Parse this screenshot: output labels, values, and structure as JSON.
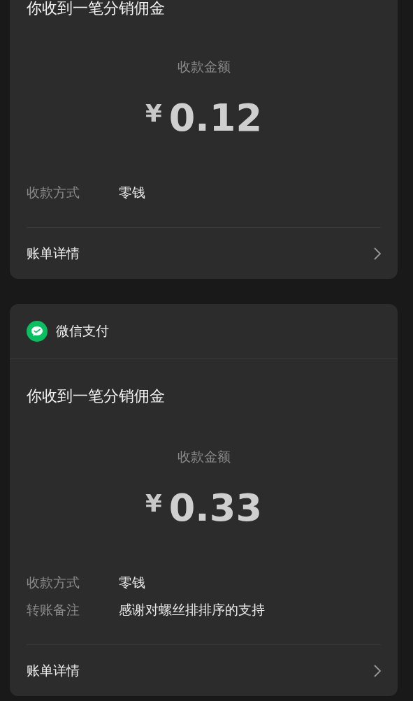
{
  "messages": [
    {
      "title": "你收到一笔分销佣金",
      "amount_label": "收款金额",
      "currency": "¥",
      "amount": "0.12",
      "details": [
        {
          "label": "收款方式",
          "value": "零钱"
        }
      ],
      "link": "账单详情"
    },
    {
      "app": "微信支付",
      "title": "你收到一笔分销佣金",
      "amount_label": "收款金额",
      "currency": "¥",
      "amount": "0.33",
      "details": [
        {
          "label": "收款方式",
          "value": "零钱"
        },
        {
          "label": "转账备注",
          "value": "感谢对螺丝排排序的支持"
        }
      ],
      "link": "账单详情"
    }
  ]
}
